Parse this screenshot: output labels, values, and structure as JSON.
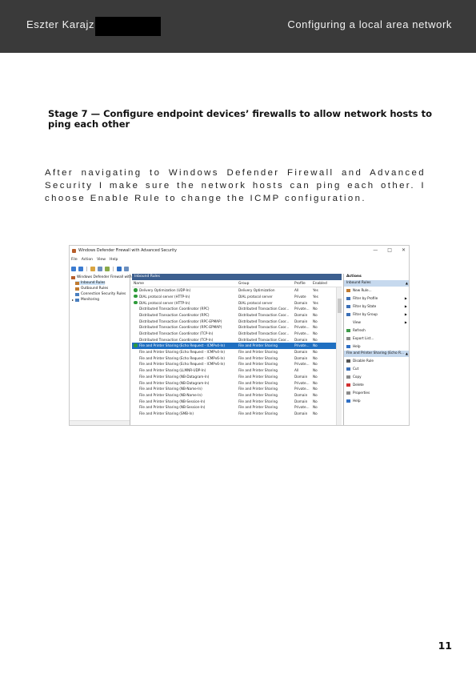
{
  "header": {
    "author": "Eszter Karajz",
    "title": "Configuring a local area network"
  },
  "stage_title": "Stage 7 — Configure endpoint devices’ firewalls to allow network hosts to ping each other",
  "body": "After navigating to Windows Defender Firewall and Advanced Security I make sure the network hosts can ping each other. I choose Enable Rule to change the ICMP configuration.",
  "page_number": "11",
  "screenshot": {
    "window_title": "Windows Defender Firewall with Advanced Security",
    "window_controls": [
      "—",
      "□",
      "✕"
    ],
    "menu": [
      "File",
      "Action",
      "View",
      "Help"
    ],
    "tree": [
      {
        "label": "Windows Defender Firewall with",
        "icon_color": "#b65d2a"
      },
      {
        "label": "Inbound Rules",
        "icon_color": "#c07a2f"
      },
      {
        "label": "Outbound Rules",
        "icon_color": "#c07a2f"
      },
      {
        "label": "Connection Security Rules",
        "icon_color": "#4a7fbf"
      },
      {
        "label": "Monitoring",
        "icon_color": "#4a7fbf"
      }
    ],
    "center_header": "Inbound Rules",
    "columns": {
      "name": "Name",
      "group": "Group",
      "profile": "Profile",
      "enabled": "Enabled"
    },
    "rules": [
      {
        "name": "Delivery Optimization (UDP-In)",
        "group": "Delivery Optimization",
        "profile": "All",
        "enabled": "Yes",
        "checked": true
      },
      {
        "name": "DIAL protocol server (HTTP-In)",
        "group": "DIAL protocol server",
        "profile": "Private",
        "enabled": "Yes",
        "checked": true
      },
      {
        "name": "DIAL protocol server (HTTP-In)",
        "group": "DIAL protocol server",
        "profile": "Domain",
        "enabled": "Yes",
        "checked": true
      },
      {
        "name": "Distributed Transaction Coordinator (RPC)",
        "group": "Distributed Transaction Coor...",
        "profile": "Private...",
        "enabled": "No",
        "checked": false
      },
      {
        "name": "Distributed Transaction Coordinator (RPC)",
        "group": "Distributed Transaction Coor...",
        "profile": "Domain",
        "enabled": "No",
        "checked": false
      },
      {
        "name": "Distributed Transaction Coordinator (RPC-EPMAP)",
        "group": "Distributed Transaction Coor...",
        "profile": "Domain",
        "enabled": "No",
        "checked": false
      },
      {
        "name": "Distributed Transaction Coordinator (RPC-EPMAP)",
        "group": "Distributed Transaction Coor...",
        "profile": "Private...",
        "enabled": "No",
        "checked": false
      },
      {
        "name": "Distributed Transaction Coordinator (TCP-In)",
        "group": "Distributed Transaction Coor...",
        "profile": "Private...",
        "enabled": "No",
        "checked": false
      },
      {
        "name": "Distributed Transaction Coordinator (TCP-In)",
        "group": "Distributed Transaction Coor...",
        "profile": "Domain",
        "enabled": "No",
        "checked": false
      },
      {
        "name": "File and Printer Sharing (Echo Request - ICMPv4-In)",
        "group": "File and Printer Sharing",
        "profile": "Private...",
        "enabled": "No",
        "checked": true,
        "selected": true
      },
      {
        "name": "File and Printer Sharing (Echo Request - ICMPv4-In)",
        "group": "File and Printer Sharing",
        "profile": "Domain",
        "enabled": "No",
        "checked": false
      },
      {
        "name": "File and Printer Sharing (Echo Request - ICMPv6-In)",
        "group": "File and Printer Sharing",
        "profile": "Domain",
        "enabled": "No",
        "checked": false
      },
      {
        "name": "File and Printer Sharing (Echo Request - ICMPv6-In)",
        "group": "File and Printer Sharing",
        "profile": "Private...",
        "enabled": "No",
        "checked": false
      },
      {
        "name": "File and Printer Sharing (LLMNR-UDP-In)",
        "group": "File and Printer Sharing",
        "profile": "All",
        "enabled": "No",
        "checked": false
      },
      {
        "name": "File and Printer Sharing (NB-Datagram-In)",
        "group": "File and Printer Sharing",
        "profile": "Domain",
        "enabled": "No",
        "checked": false
      },
      {
        "name": "File and Printer Sharing (NB-Datagram-In)",
        "group": "File and Printer Sharing",
        "profile": "Private...",
        "enabled": "No",
        "checked": false
      },
      {
        "name": "File and Printer Sharing (NB-Name-In)",
        "group": "File and Printer Sharing",
        "profile": "Private...",
        "enabled": "No",
        "checked": false
      },
      {
        "name": "File and Printer Sharing (NB-Name-In)",
        "group": "File and Printer Sharing",
        "profile": "Domain",
        "enabled": "No",
        "checked": false
      },
      {
        "name": "File and Printer Sharing (NB-Session-In)",
        "group": "File and Printer Sharing",
        "profile": "Domain",
        "enabled": "No",
        "checked": false
      },
      {
        "name": "File and Printer Sharing (NB-Session-In)",
        "group": "File and Printer Sharing",
        "profile": "Private...",
        "enabled": "No",
        "checked": false
      },
      {
        "name": "File and Printer Sharing (SMB-In)",
        "group": "File and Printer Sharing",
        "profile": "Domain",
        "enabled": "No",
        "checked": false
      }
    ],
    "actions_title": "Actions",
    "actions_section1": "Inbound Rules",
    "actions1": [
      {
        "label": "New Rule...",
        "icon_color": "#c07a2f",
        "submenu": false
      },
      {
        "label": "Filter by Profile",
        "icon_color": "#3b6fb6",
        "submenu": true
      },
      {
        "label": "Filter by State",
        "icon_color": "#3b6fb6",
        "submenu": true
      },
      {
        "label": "Filter by Group",
        "icon_color": "#3b6fb6",
        "submenu": true
      },
      {
        "label": "View",
        "icon_color": "#ffffff",
        "submenu": true
      },
      {
        "label": "Refresh",
        "icon_color": "#3e9a4a",
        "submenu": false
      },
      {
        "label": "Export List...",
        "icon_color": "#8a8a8a",
        "submenu": false
      },
      {
        "label": "Help",
        "icon_color": "#2f6fc4",
        "submenu": false
      }
    ],
    "actions_section2": "File and Printer Sharing (Echo R...",
    "actions2": [
      {
        "label": "Disable Rule",
        "icon_color": "#555555"
      },
      {
        "label": "Cut",
        "icon_color": "#3b6fb6"
      },
      {
        "label": "Copy",
        "icon_color": "#8a8a8a"
      },
      {
        "label": "Delete",
        "icon_color": "#d03030"
      },
      {
        "label": "Properties",
        "icon_color": "#8a8a8a"
      },
      {
        "label": "Help",
        "icon_color": "#2f6fc4"
      }
    ]
  }
}
